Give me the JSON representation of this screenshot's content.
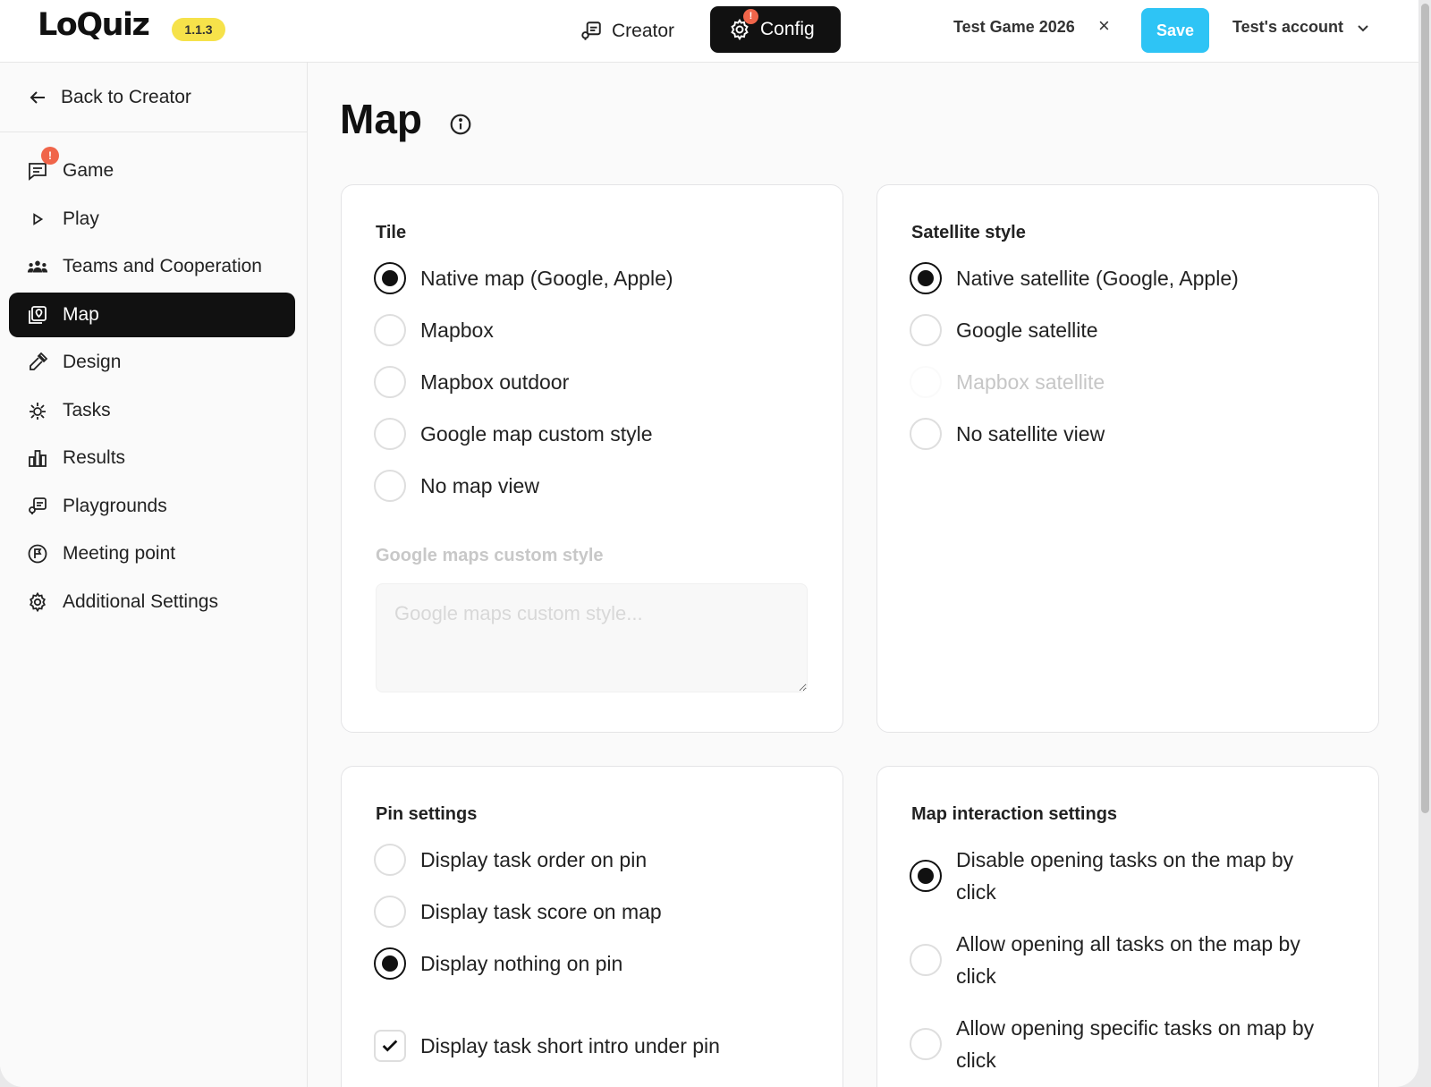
{
  "header": {
    "logo": "LoQuiz",
    "version": "1.1.3",
    "nav": {
      "creator_label": "Creator",
      "config_label": "Config",
      "config_badge": "!"
    },
    "game_name": "Test Game 2026",
    "close_label": "×",
    "save_label": "Save",
    "account_label": "Test's account"
  },
  "sidebar": {
    "back_label": "Back to Creator",
    "items": [
      {
        "label": "Game",
        "icon": "chat-icon",
        "badge": "!"
      },
      {
        "label": "Play",
        "icon": "play-icon"
      },
      {
        "label": "Teams and Cooperation",
        "icon": "team-icon"
      },
      {
        "label": "Map",
        "icon": "map-icon",
        "active": true
      },
      {
        "label": "Design",
        "icon": "pipette-icon"
      },
      {
        "label": "Tasks",
        "icon": "sparkle-icon"
      },
      {
        "label": "Results",
        "icon": "bar-chart-icon"
      },
      {
        "label": "Playgrounds",
        "icon": "playground-icon"
      },
      {
        "label": "Meeting point",
        "icon": "flag-circle-icon"
      },
      {
        "label": "Additional Settings",
        "icon": "gear-icon"
      }
    ]
  },
  "page": {
    "title": "Map"
  },
  "tile": {
    "title": "Tile",
    "options": [
      {
        "label": "Native map (Google, Apple)",
        "selected": true
      },
      {
        "label": "Mapbox",
        "selected": false
      },
      {
        "label": "Mapbox outdoor",
        "selected": false
      },
      {
        "label": "Google map custom style",
        "selected": false
      },
      {
        "label": "No map view",
        "selected": false
      }
    ],
    "custom_style_label": "Google maps custom style",
    "custom_style_placeholder": "Google maps custom style..."
  },
  "satellite": {
    "title": "Satellite style",
    "options": [
      {
        "label": "Native satellite (Google, Apple)",
        "selected": true
      },
      {
        "label": "Google satellite",
        "selected": false
      },
      {
        "label": "Mapbox satellite",
        "selected": false,
        "disabled": true
      },
      {
        "label": "No satellite view",
        "selected": false
      }
    ]
  },
  "pins": {
    "title": "Pin settings",
    "options": [
      {
        "label": "Display task order on pin",
        "selected": false
      },
      {
        "label": "Display task score on map",
        "selected": false
      },
      {
        "label": "Display nothing on pin",
        "selected": true
      }
    ],
    "checkbox_label": "Display task short intro under pin",
    "checkbox_checked": true
  },
  "interaction": {
    "title": "Map interaction settings",
    "options": [
      {
        "label": "Disable opening tasks on the map by click",
        "selected": true
      },
      {
        "label": "Allow opening all tasks on the map by click",
        "selected": false
      },
      {
        "label": "Allow opening specific tasks on map by click",
        "selected": false
      }
    ]
  }
}
